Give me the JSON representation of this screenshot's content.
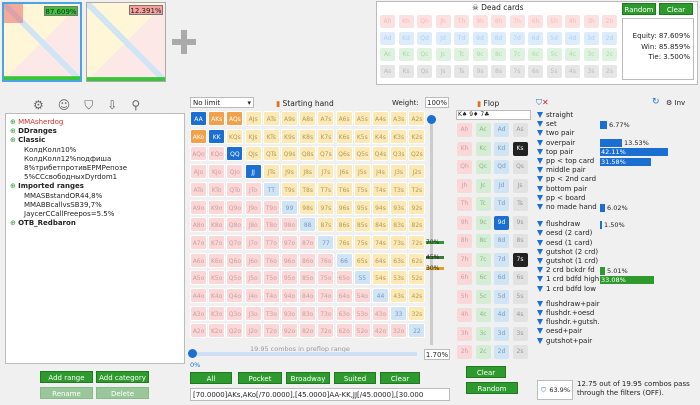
{
  "thumbs": [
    {
      "pct": "87.609%",
      "color": "#3ac43a"
    },
    {
      "pct": "12.391%",
      "color": "#e84a4a"
    }
  ],
  "dead": {
    "title": "Dead cards",
    "random": "Random",
    "clear": "Clear",
    "equity": "Equity: 87.609%",
    "win": "Win: 85.859%",
    "tie": "Tie: 3.500%",
    "ranks": [
      "A",
      "K",
      "Q",
      "J",
      "T",
      "9",
      "8",
      "7",
      "6",
      "5",
      "4",
      "3",
      "2"
    ]
  },
  "toolbar": {
    "limit": "No limit",
    "starting_hand": "Starting hand",
    "weight_label": "Weight:",
    "weight_value": "100%"
  },
  "tree": [
    "MMAsherdog",
    "DDranges",
    "Classic",
    "КолдКолл10%",
    "КолдКолл12%подфиша",
    "8%трибетпротивEPMРепозе",
    "5%CCсвободныхDyrdom1",
    "Imported ranges",
    "MMASBstandOR44,8%",
    "MMABBcallvsSB39,7%",
    "JaycerCCallFreepos=5.5%",
    "OTB_Redbaron"
  ],
  "grid_ranks": [
    "A",
    "K",
    "Q",
    "J",
    "T",
    "9",
    "8",
    "7",
    "6",
    "5",
    "4",
    "3",
    "2"
  ],
  "side_pcts": [
    "70%",
    "45%",
    "30%"
  ],
  "combos": "19.95 combos in preflop range",
  "range_pct": "1.70%",
  "slider_pct": "0%",
  "range_buttons": [
    "All",
    "Pocket",
    "Broadway",
    "Suited",
    "Clear"
  ],
  "range_text": "[70.0000]AKs,AKo[/70.0000],[45.0000]AA-KK,JJ[/45.0000],[30.000",
  "left_buttons": [
    "Add range",
    "Add category",
    "Rename",
    "Delete"
  ],
  "flop": {
    "title": "Flop",
    "clear": "Clear",
    "random": "Random",
    "inv": "Inv"
  },
  "filters": [
    {
      "label": "straight",
      "pct": ""
    },
    {
      "label": "set",
      "pct": "6.77%"
    },
    {
      "label": "two pair",
      "pct": ""
    },
    {
      "label": "overpair",
      "pct": "13.53%"
    },
    {
      "label": "top pair",
      "pct": "42.11%"
    },
    {
      "label": "pp < top card",
      "pct": "31.58%"
    },
    {
      "label": "middle pair",
      "pct": ""
    },
    {
      "label": "pp < 2nd card",
      "pct": ""
    },
    {
      "label": "bottom pair",
      "pct": ""
    },
    {
      "label": "pp < board",
      "pct": ""
    },
    {
      "label": "no made hand",
      "pct": "6.02%"
    },
    {
      "label": "flushdraw",
      "pct": "1.50%"
    },
    {
      "label": "oesd (2 card)",
      "pct": ""
    },
    {
      "label": "oesd (1 card)",
      "pct": ""
    },
    {
      "label": "gutshot (2 crd)",
      "pct": ""
    },
    {
      "label": "gutshot (1 crd)",
      "pct": ""
    },
    {
      "label": "2 crd bckdr fd",
      "pct": "5.01%"
    },
    {
      "label": "1 crd bdfd high",
      "pct": "33.08%"
    },
    {
      "label": "1 crd bdfd low",
      "pct": ""
    },
    {
      "label": "flushdraw+pair",
      "pct": ""
    },
    {
      "label": "flushdr.+oesd",
      "pct": ""
    },
    {
      "label": "flushdr.+gutsh.",
      "pct": ""
    },
    {
      "label": "oesd+pair",
      "pct": ""
    },
    {
      "label": "gutshot+pair",
      "pct": ""
    }
  ],
  "summary": {
    "badge": "63.9%",
    "text": "12.75 out of 19.95 combos pass through the filters (OFF)."
  }
}
